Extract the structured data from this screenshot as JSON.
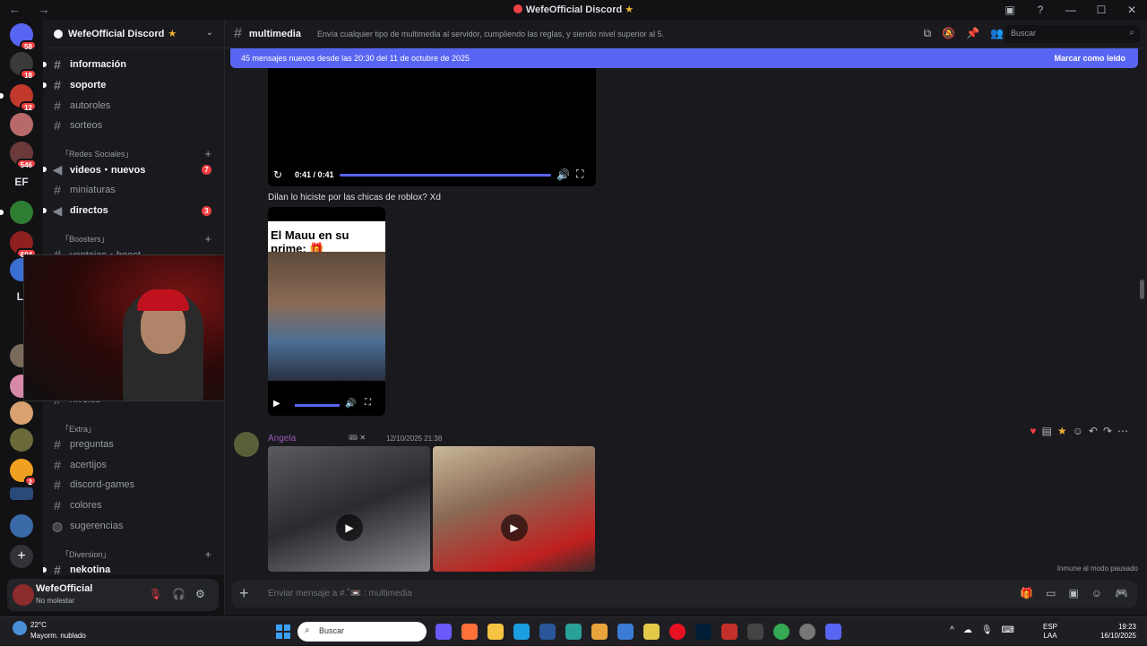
{
  "window": {
    "title": "WefeOfficial Discord",
    "controls": [
      "—",
      "☐",
      "✕"
    ]
  },
  "guilds": [
    {
      "badge": "58"
    },
    {
      "badge": "18"
    },
    {
      "badge": "12"
    },
    {
      "badge": ""
    },
    {
      "badge": "546"
    },
    {
      "label": "EF"
    },
    {
      "badge": ""
    },
    {
      "badge": "604"
    },
    {
      "badge": ""
    },
    {
      "label": "LI"
    },
    {
      "badge": ""
    },
    {
      "badge": ""
    },
    {
      "badge": ""
    },
    {
      "badge": ""
    },
    {
      "badge": ""
    },
    {
      "badge": "2"
    },
    {
      "badge": ""
    },
    {
      "badge": ""
    }
  ],
  "server": {
    "name": "WefeOfficial Discord",
    "channels": [
      {
        "name": "información",
        "unread": true
      },
      {
        "name": "soporte",
        "unread": true
      },
      {
        "name": "autoroles",
        "unread": false
      },
      {
        "name": "sorteos",
        "unread": false
      }
    ],
    "cat_social": "「Redes Sociales」",
    "social_channels": [
      {
        "name": "videos・nuevos",
        "unread": true,
        "count": "7"
      },
      {
        "name": "miniaturas",
        "unread": false
      },
      {
        "name": "directos",
        "unread": true,
        "count": "3"
      }
    ],
    "cat_boosters": "「Boosters」",
    "booster_channel": "ventajas・boost",
    "niveles": "niveles",
    "cat_extra": "「Extra」",
    "extra_channels": [
      {
        "name": "preguntas"
      },
      {
        "name": "acertijos"
      },
      {
        "name": "discord-games"
      },
      {
        "name": "colores"
      },
      {
        "name": "sugerencias"
      }
    ],
    "cat_diversion": "「Diversion」",
    "diversion_channel": "nekotina"
  },
  "user": {
    "name": "WefeOfficial",
    "status": "No molestar"
  },
  "channel": {
    "name": "multimedia",
    "topic": "Envía cualquier tipo de multimedia al servidor, cumpliendo las reglas, y siendo nivel superior al 5.",
    "search_placeholder": "Buscar"
  },
  "new_messages": {
    "text": "45 mensajes nuevos desde las 20:30 del 11 de octubre de 2025",
    "mark_read": "Marcar como leído"
  },
  "video1": {
    "time": "0:41 / 0:41",
    "progress": 1.0
  },
  "message1": {
    "text": "Dilan lo hiciste por las chicas de roblox? Xd"
  },
  "gif": {
    "caption": "El Mauu en su prime: 🎁",
    "progress": 0.4
  },
  "message2": {
    "author": "Angela",
    "tags": "🎟 ✕",
    "timestamp": "12/10/2025 21:38"
  },
  "immune": "Inmune al modo pausado",
  "composer": {
    "placeholder": "Enviar mensaje a #.˚📼 : multimedia"
  },
  "taskbar": {
    "temp": "22°C",
    "weather": "Mayorm. nublado",
    "search": "Buscar",
    "lang_top": "ESP",
    "lang_bottom": "LAA",
    "time": "19:23",
    "date": "16/10/2025"
  }
}
